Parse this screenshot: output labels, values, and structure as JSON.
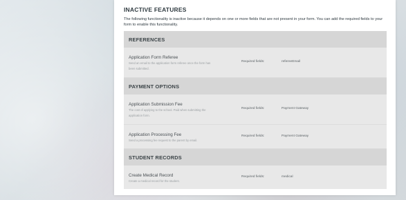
{
  "panel": {
    "title": "INACTIVE FEATURES",
    "description": "The following functionality is inactive because it depends on one or more fields that are not present in your form. You can add the required fields to your form to enable this functionality."
  },
  "sections": [
    {
      "header": "REFERENCES",
      "features": [
        {
          "name": "Application Form Referee",
          "description": "Send an email to the application form referee once the form has been submitted.",
          "required_label": "Required fields:",
          "required_value": "refereeEmail"
        }
      ]
    },
    {
      "header": "PAYMENT OPTIONS",
      "features": [
        {
          "name": "Application Submission Fee",
          "description": "The cost of applying to the school. Paid when submitting the application form.",
          "required_label": "Required fields:",
          "required_value": "Payment Gateway"
        },
        {
          "name": "Application Processing Fee",
          "description": "Send a processing fee request to the parent by email.",
          "required_label": "Required fields:",
          "required_value": "Payment Gateway"
        }
      ]
    },
    {
      "header": "STUDENT RECORDS",
      "features": [
        {
          "name": "Create Medical Record",
          "description": "Create a medical record for the student.",
          "required_label": "Required fields:",
          "required_value": "medical"
        }
      ]
    }
  ]
}
